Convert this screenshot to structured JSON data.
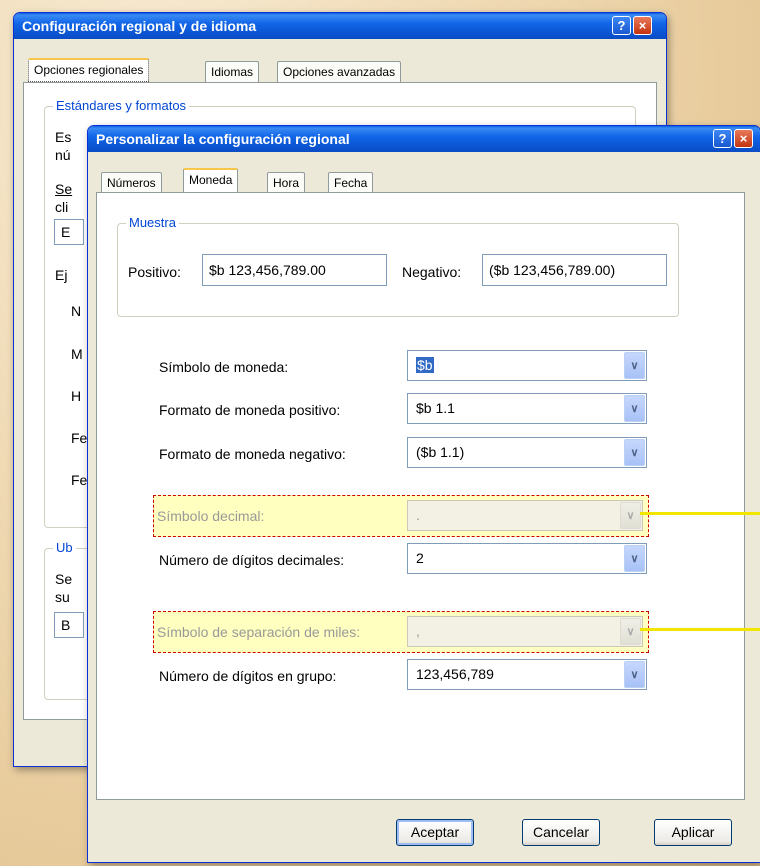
{
  "back_dialog": {
    "title": "Configuración regional y de idioma",
    "help_glyph": "?",
    "close_glyph": "×",
    "tabs": [
      "Opciones regionales",
      "Idiomas",
      "Opciones avanzadas"
    ],
    "group1_legend": "Estándares y formatos",
    "clipped_text": [
      "Es",
      "nú",
      "Se",
      "cli",
      "E",
      "Ej",
      "N",
      "M",
      "H",
      "Fe",
      "Fe"
    ],
    "group2_legend": "Ub",
    "clipped_text2": [
      "Se",
      "su",
      "B"
    ]
  },
  "front_dialog": {
    "title": "Personalizar la configuración regional",
    "help_glyph": "?",
    "close_glyph": "×",
    "tabs": [
      "Números",
      "Moneda",
      "Hora",
      "Fecha"
    ],
    "active_tab": "Moneda",
    "sample": {
      "legend": "Muestra",
      "positive_label": "Positivo:",
      "positive_value": "$b 123,456,789.00",
      "negative_label": "Negativo:",
      "negative_value": "($b 123,456,789.00)"
    },
    "fields": {
      "currency_symbol": {
        "label": "Símbolo de moneda:",
        "value": "$b"
      },
      "positive_format": {
        "label": "Formato de moneda positivo:",
        "value": "$b 1.1"
      },
      "negative_format": {
        "label": "Formato de moneda negativo:",
        "value": "($b 1.1)"
      },
      "decimal_symbol": {
        "label": "Símbolo decimal:",
        "value": "."
      },
      "decimal_digits": {
        "label": "Número de dígitos decimales:",
        "value": "2"
      },
      "thousands_symbol": {
        "label": "Símbolo de separación de miles:",
        "value": ","
      },
      "group_digits": {
        "label": "Número de dígitos en grupo:",
        "value": "123,456,789"
      }
    },
    "buttons": {
      "ok": "Aceptar",
      "cancel": "Cancelar",
      "apply": "Aplicar"
    }
  },
  "colors": {
    "highlight_fill": "#ffffc0",
    "highlight_border": "#cc0000",
    "callout_line": "#f2e600"
  },
  "icons": {
    "dropdown": "chevron-down-icon"
  }
}
